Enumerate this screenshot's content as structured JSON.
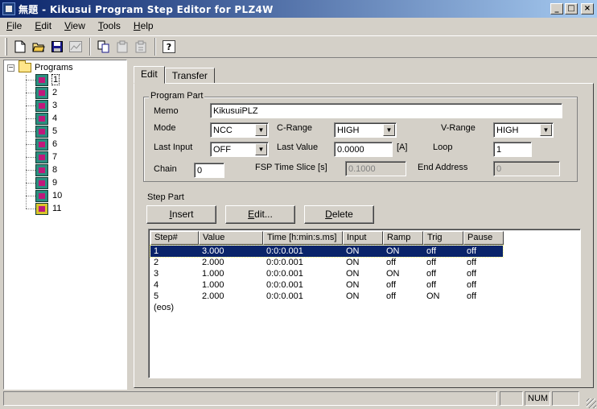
{
  "window": {
    "title": "無題 - Kikusui Program Step Editor for PLZ4W",
    "min_btn": "_",
    "max_btn": "□",
    "close_btn": "×"
  },
  "menu": [
    {
      "u": "F",
      "rest": "ile"
    },
    {
      "u": "E",
      "rest": "dit"
    },
    {
      "u": "V",
      "rest": "iew"
    },
    {
      "u": "T",
      "rest": "ools"
    },
    {
      "u": "H",
      "rest": "elp"
    }
  ],
  "toolbar": {
    "icons": [
      "new-file-icon",
      "open-folder-icon",
      "save-icon",
      "chart-icon",
      "copy-icon",
      "paste-icon",
      "paste-special-icon",
      "help-icon"
    ],
    "help_label": "?"
  },
  "tree": {
    "expander": "−",
    "root_label": "Programs",
    "items": [
      "1",
      "2",
      "3",
      "4",
      "5",
      "6",
      "7",
      "8",
      "9",
      "10",
      "11"
    ],
    "selected": "1"
  },
  "tabs": [
    "Edit",
    "Transfer"
  ],
  "program_part": {
    "title": "Program Part",
    "memo_label": "Memo",
    "memo_value": "KikusuiPLZ",
    "mode_label": "Mode",
    "mode_value": "NCC",
    "crange_label": "C-Range",
    "crange_value": "HIGH",
    "vrange_label": "V-Range",
    "vrange_value": "HIGH",
    "last_input_label": "Last Input",
    "last_input_value": "OFF",
    "last_value_label": "Last Value",
    "last_value_value": "0.0000",
    "last_value_unit": "[A]",
    "loop_label": "Loop",
    "loop_value": "1",
    "chain_label": "Chain",
    "chain_value": "0",
    "fsp_label": "FSP Time Slice [s]",
    "fsp_value": "0.1000",
    "end_address_label": "End Address",
    "end_address_value": "0"
  },
  "step_part": {
    "title": "Step Part",
    "insert_u": "I",
    "insert_rest": "nsert",
    "edit_u": "E",
    "edit_rest": "dit...",
    "delete_u": "D",
    "delete_rest": "elete"
  },
  "table": {
    "columns": [
      "Step#",
      "Value",
      "Time [h:min:s.ms]",
      "Input",
      "Ramp",
      "Trig",
      "Pause"
    ],
    "rows": [
      [
        "1",
        "3.000",
        "0:0:0.001",
        "ON",
        "ON",
        "off",
        "off"
      ],
      [
        "2",
        "2.000",
        "0:0:0.001",
        "ON",
        "off",
        "off",
        "off"
      ],
      [
        "3",
        "1.000",
        "0:0:0.001",
        "ON",
        "ON",
        "off",
        "off"
      ],
      [
        "4",
        "1.000",
        "0:0:0.001",
        "ON",
        "off",
        "off",
        "off"
      ],
      [
        "5",
        "2.000",
        "0:0:0.001",
        "ON",
        "off",
        "ON",
        "off"
      ]
    ],
    "eos": "(eos)",
    "selected_row": 0
  },
  "status": {
    "num": "NUM"
  },
  "colors": {
    "title_start": "#0a246a",
    "title_end": "#a6caf0",
    "face": "#d4d0c8",
    "selection": "#0a246a"
  }
}
